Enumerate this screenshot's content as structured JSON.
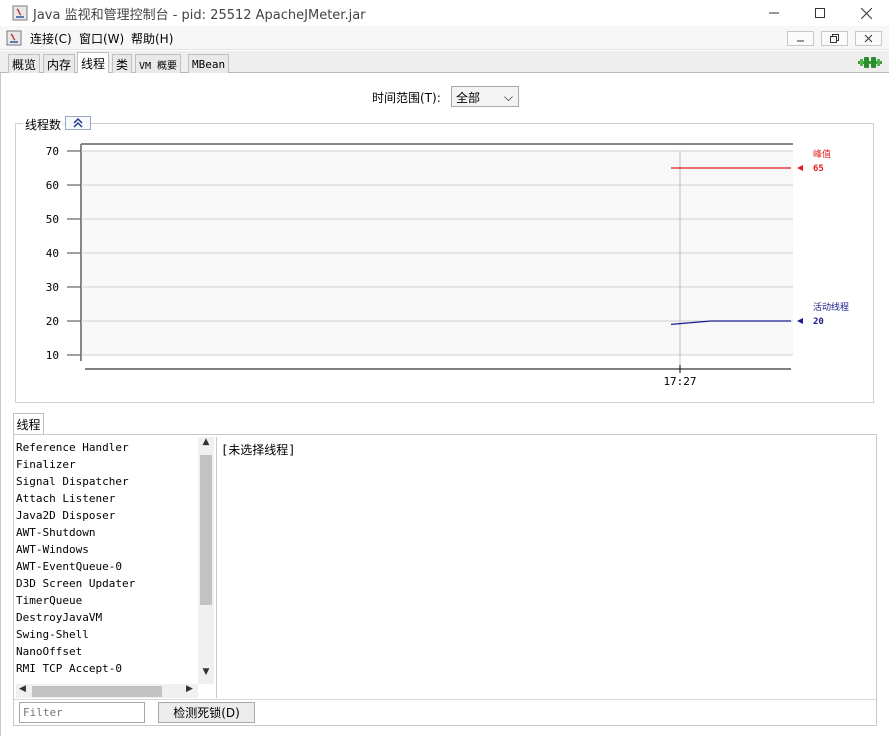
{
  "window": {
    "title": "Java 监视和管理控制台 - pid: 25512 ApacheJMeter.jar",
    "min_glyph": "—",
    "max_glyph": "☐",
    "close_glyph": "✕"
  },
  "menu": {
    "items": [
      "连接(C)",
      "窗口(W)",
      "帮助(H)"
    ],
    "mdi_buttons": [
      "▁",
      "❐",
      "✕"
    ]
  },
  "tabs": [
    {
      "label": "概览"
    },
    {
      "label": "内存"
    },
    {
      "label": "线程",
      "active": true
    },
    {
      "label": "类"
    },
    {
      "label": "VM 概要"
    },
    {
      "label": "MBean"
    }
  ],
  "time_range": {
    "label": "时间范围(T):",
    "value": "全部",
    "caret": "⌵"
  },
  "chart": {
    "panel_title": "线程数",
    "collapse_glyph": "⌃"
  },
  "chart_data": {
    "type": "line",
    "ylim": [
      10,
      70
    ],
    "yticks": [
      70,
      60,
      50,
      40,
      30,
      20,
      10
    ],
    "xticks": [
      "17:27"
    ],
    "series": [
      {
        "name": "峰值",
        "last_value": 65,
        "color": "#e31b1b",
        "values": [
          65,
          65
        ]
      },
      {
        "name": "活动线程",
        "last_value": 20,
        "color": "#1c1c8c",
        "values": [
          19,
          20,
          20,
          20
        ]
      }
    ]
  },
  "threads": {
    "tab_label": "线程",
    "list": [
      "Reference Handler",
      "Finalizer",
      "Signal Dispatcher",
      "Attach Listener",
      "Java2D Disposer",
      "AWT-Shutdown",
      "AWT-Windows",
      "AWT-EventQueue-0",
      "D3D Screen Updater",
      "TimerQueue",
      "DestroyJavaVM",
      "Swing-Shell",
      "NanoOffset",
      "RMI TCP Accept-0"
    ],
    "detail_text": "[未选择线程]",
    "filter_placeholder": "Filter",
    "deadlock_button": "检测死锁(D)"
  }
}
